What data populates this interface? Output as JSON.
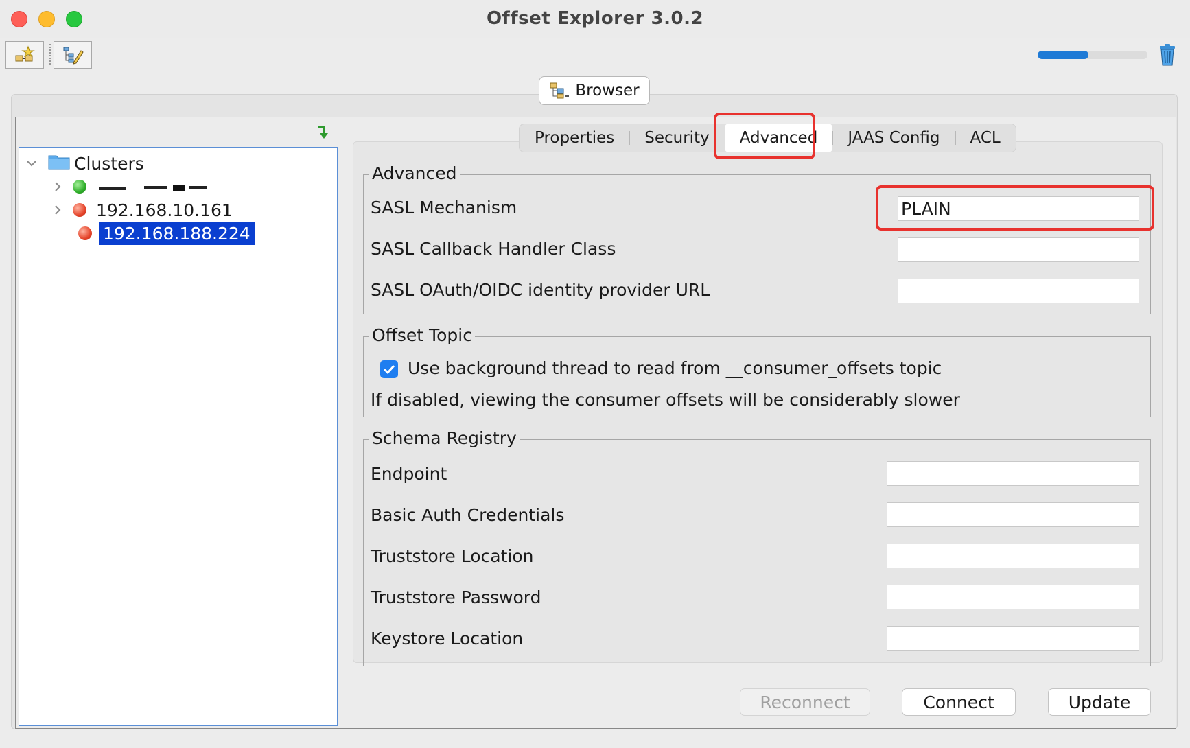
{
  "window": {
    "title": "Offset Explorer  3.0.2"
  },
  "toolbar": {
    "buttons": [
      {
        "icon": "add-connection-icon"
      },
      {
        "icon": "edit-tree-icon"
      }
    ],
    "progress_fraction": 0.46,
    "trash_icon": "trash-icon"
  },
  "browser_button": {
    "label": "Browser"
  },
  "tree": {
    "root": "Clusters",
    "items": [
      {
        "label": "",
        "status": "green",
        "expandable": true,
        "redacted": true
      },
      {
        "label": "192.168.10.161",
        "status": "red",
        "expandable": true
      },
      {
        "label": "192.168.188.224",
        "status": "red",
        "expandable": false,
        "selected": true
      }
    ]
  },
  "tabs": [
    {
      "label": "Properties"
    },
    {
      "label": "Security"
    },
    {
      "label": "Advanced",
      "active": true
    },
    {
      "label": "JAAS Config"
    },
    {
      "label": "ACL"
    }
  ],
  "advanced": {
    "title": "Advanced",
    "sasl_mechanism_label": "SASL Mechanism",
    "sasl_mechanism_value": "PLAIN",
    "callback_label": "SASL Callback Handler Class",
    "callback_value": "",
    "oauth_label": "SASL OAuth/OIDC identity provider URL",
    "oauth_value": ""
  },
  "offset_topic": {
    "title": "Offset Topic",
    "checkbox_label": "Use background thread to read from __consumer_offsets topic",
    "checked": true,
    "note": "If disabled, viewing the consumer offsets will be considerably slower"
  },
  "schema_registry": {
    "title": "Schema Registry",
    "endpoint_label": "Endpoint",
    "basic_auth_label": "Basic Auth Credentials",
    "truststore_location_label": "Truststore Location",
    "truststore_password_label": "Truststore Password",
    "keystore_location_label": "Keystore Location"
  },
  "actions": {
    "reconnect": "Reconnect",
    "connect": "Connect",
    "update": "Update"
  },
  "colors": {
    "selection": "#0a3fd0",
    "highlight": "#e8322e",
    "checkbox": "#1f7ef0",
    "progress": "#1e7ad6"
  }
}
